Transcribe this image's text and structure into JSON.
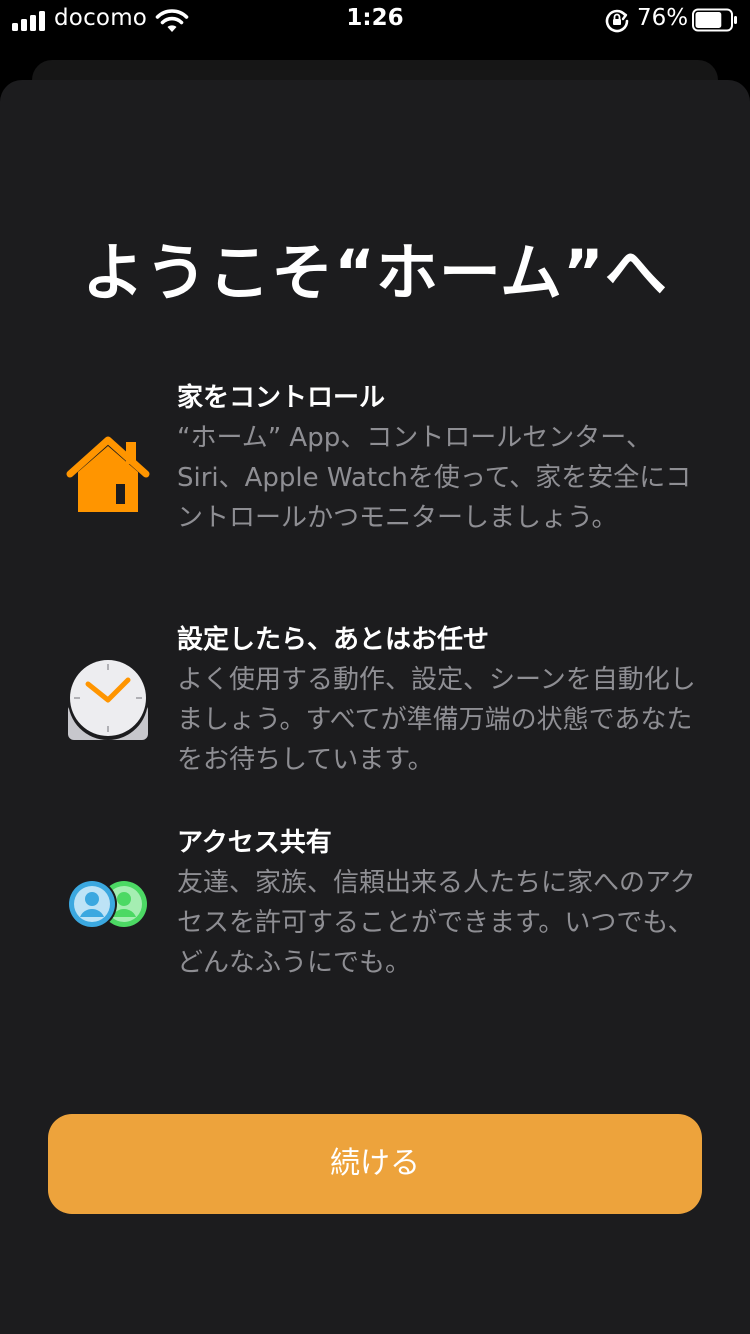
{
  "status_bar": {
    "carrier": "docomo",
    "time": "1:26",
    "battery_percent": "76%",
    "battery_level": 0.76,
    "signal_bars": 4
  },
  "onboarding": {
    "title": "ようこそ“ホーム”へ",
    "features": [
      {
        "icon": "house-icon",
        "icon_color": "#ff9500",
        "heading": "家をコントロール",
        "body": "“ホーム” App、コントロールセンター、Siri、Apple Watchを使って、家を安全にコントロールかつモニターしましょう。"
      },
      {
        "icon": "clock-icon",
        "icon_color": "#ff9500",
        "heading": "設定したら、あとはお任せ",
        "body": "よく使用する動作、設定、シーンを自動化しましょう。すべてが準備万端の状態であなたをお待ちしています。"
      },
      {
        "icon": "people-icon",
        "icon_color": "#3ba8e0",
        "heading": "アクセス共有",
        "body": "友達、家族、信頼出来る人たちに家へのアクセスを許可することができます。いつでも、どんなふうにでも。"
      }
    ],
    "continue_label": "続ける",
    "accent_color": "#eda33c"
  }
}
